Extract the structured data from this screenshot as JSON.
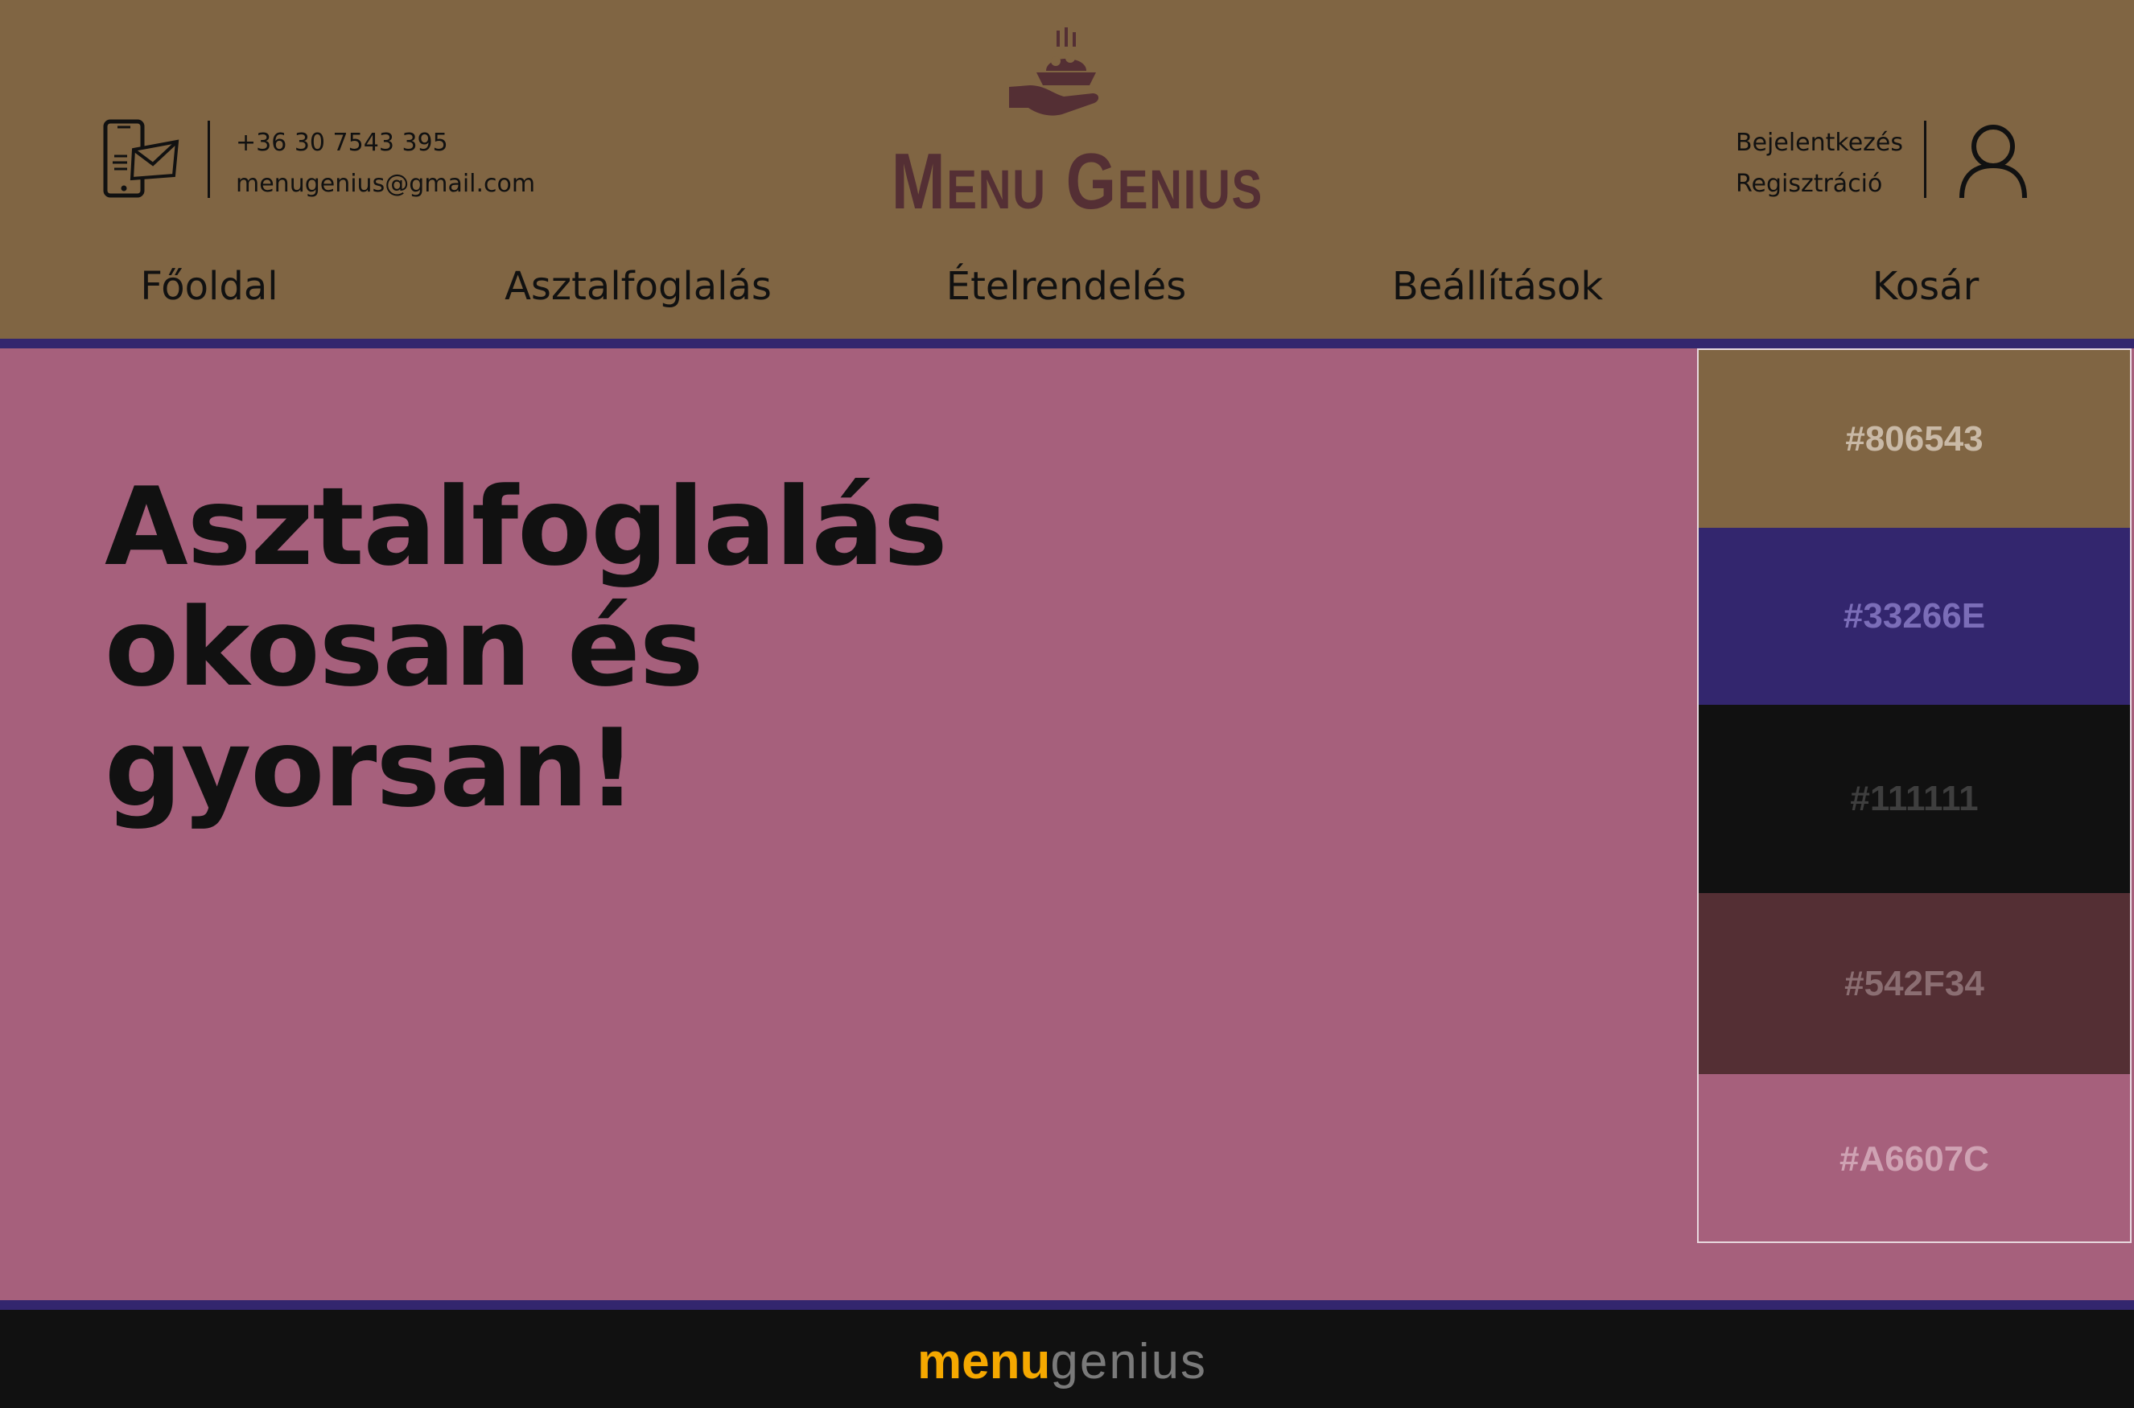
{
  "header": {
    "phone": "+36 30 7543 395",
    "email": "menugenius@gmail.com",
    "brand": "Menu Genius",
    "login": "Bejelentkezés",
    "register": "Regisztráció"
  },
  "nav": {
    "items": [
      {
        "label": "Főoldal"
      },
      {
        "label": "Asztalfoglalás"
      },
      {
        "label": "Ételrendelés"
      },
      {
        "label": "Beállítások"
      },
      {
        "label": "Kosár"
      }
    ]
  },
  "hero": {
    "lines": [
      "Asztalfoglalás",
      "okosan és",
      "gyorsan!"
    ]
  },
  "palette": {
    "swatches": [
      {
        "label": "#806543",
        "color": "#806543",
        "text_color": "#C9B9A6"
      },
      {
        "label": "#33266E",
        "color": "#33266E",
        "text_color": "#7B6DB8"
      },
      {
        "label": "#111111",
        "color": "#111111",
        "text_color": "#3E3E3E"
      },
      {
        "label": "#542F34",
        "color": "#542F34",
        "text_color": "#8B6E72"
      },
      {
        "label": "#A6607C",
        "color": "#A6607C",
        "text_color": "#CFA2B3"
      }
    ]
  },
  "footer": {
    "logo_part1": "menu",
    "logo_part2": "genius"
  },
  "colors": {
    "header_bg": "#806543",
    "accent_stripe": "#33266E",
    "text": "#111111",
    "brand": "#542F34",
    "page_bg": "#A6607C",
    "footer_logo": "#F5A800"
  }
}
